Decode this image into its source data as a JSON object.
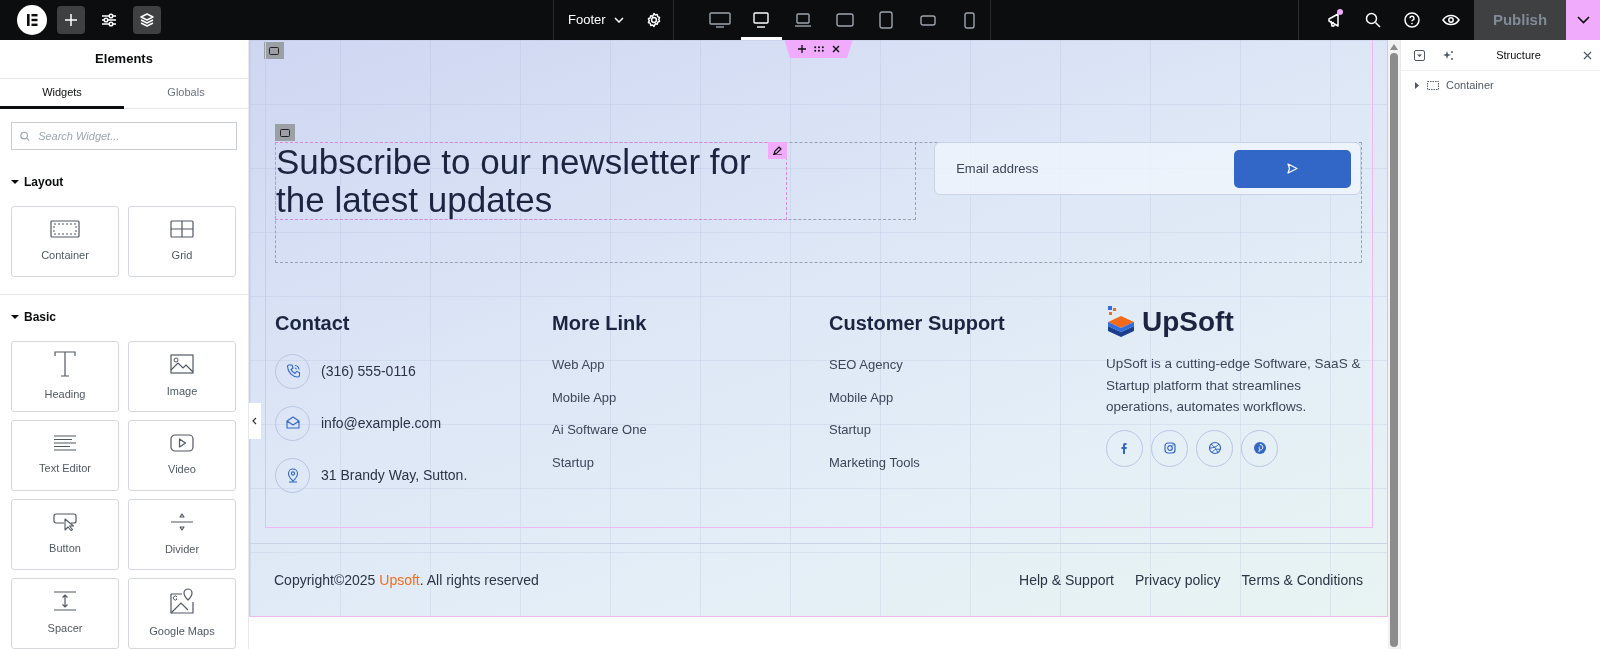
{
  "topbar": {
    "document": "Footer",
    "has_notification": true,
    "publish": {
      "label": "Publish",
      "disabled": true
    },
    "devices": [
      {
        "kind": "widescreen",
        "selected": false
      },
      {
        "kind": "desktop",
        "selected": true
      },
      {
        "kind": "laptop",
        "selected": false
      },
      {
        "kind": "tabletwide",
        "selected": false
      },
      {
        "kind": "tablet",
        "selected": false
      },
      {
        "kind": "mobilewide",
        "selected": false
      },
      {
        "kind": "mobile",
        "selected": false
      }
    ]
  },
  "panel": {
    "title": "Elements",
    "tabs": [
      {
        "label": "Widgets",
        "selected": true
      },
      {
        "label": "Globals",
        "selected": false
      }
    ],
    "search": {
      "placeholder": "Search Widget..."
    },
    "sections": [
      {
        "title": "Layout",
        "expanded": true,
        "widgets": [
          {
            "label": "Container",
            "kind": "container"
          },
          {
            "label": "Grid",
            "kind": "grid"
          }
        ]
      },
      {
        "title": "Basic",
        "expanded": true,
        "widgets": [
          {
            "label": "Heading",
            "kind": "heading"
          },
          {
            "label": "Image",
            "kind": "image"
          },
          {
            "label": "Text Editor",
            "kind": "text"
          },
          {
            "label": "Video",
            "kind": "video"
          },
          {
            "label": "Button",
            "kind": "button"
          },
          {
            "label": "Divider",
            "kind": "divider"
          },
          {
            "label": "Spacer",
            "kind": "spacer"
          },
          {
            "label": "Google Maps",
            "kind": "map"
          }
        ]
      }
    ]
  },
  "canvas": {
    "newsletter": {
      "heading": "Subscribe to our newsletter for the latest updates",
      "email": {
        "placeholder": "Email address"
      }
    },
    "contact": {
      "title": "Contact",
      "items": [
        {
          "kind": "phone",
          "text": "(316) 555-0116"
        },
        {
          "kind": "email",
          "text": "info@example.com"
        },
        {
          "kind": "location",
          "text": "31 Brandy Way, Sutton."
        }
      ]
    },
    "link_columns": [
      {
        "title": "More Link",
        "links": [
          "Web App",
          "Mobile App",
          "Ai Software One",
          "Startup"
        ]
      },
      {
        "title": "Customer Support",
        "links": [
          "SEO Agency",
          "Mobile App",
          "Startup",
          "Marketing Tools"
        ]
      }
    ],
    "brand": {
      "name": "UpSoft",
      "description": "UpSoft is a cutting-edge Software, SaaS & Startup platform that streamlines operations, automates workflows.",
      "socials": [
        {
          "kind": "facebook"
        },
        {
          "kind": "instagram"
        },
        {
          "kind": "dribbble"
        },
        {
          "kind": "pinterest"
        }
      ]
    },
    "copyright": {
      "before": "Copyright©2025 ",
      "brand": "Upsoft",
      "after": ". All rights reserved"
    },
    "bottom_links": [
      "Help & Support",
      "Privacy policy",
      "Terms & Conditions"
    ]
  },
  "structure": {
    "title": "Structure",
    "tree": [
      {
        "label": "Container",
        "expanded": false
      }
    ]
  }
}
